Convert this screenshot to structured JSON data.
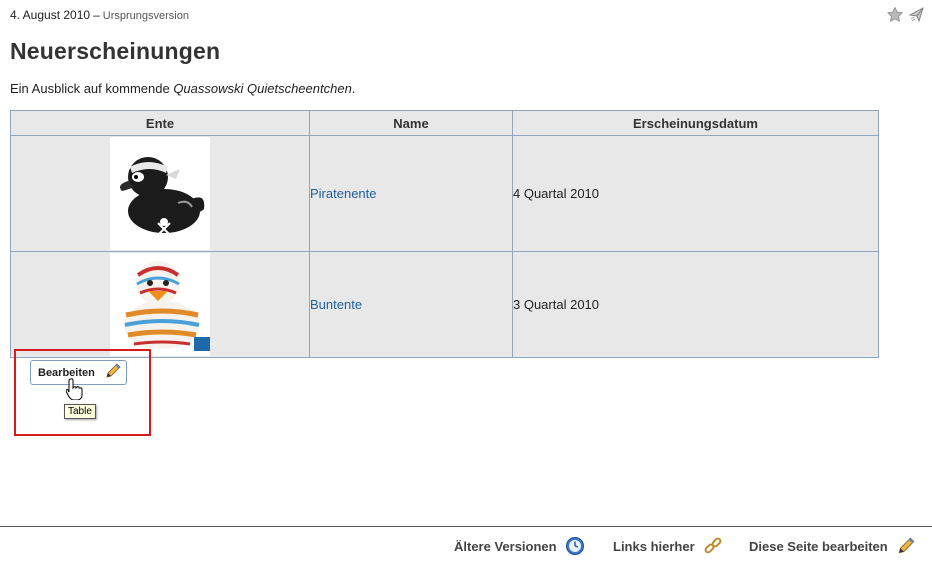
{
  "header": {
    "date": "4. August 2010",
    "separator": "–",
    "version": "Ursprungsversion",
    "icons": [
      "star-icon",
      "feed-icon"
    ]
  },
  "page": {
    "title": "Neuerscheinungen",
    "intro_text": "Ein Ausblick auf kommende ",
    "intro_emphasis": "Quassowski Quietscheentchen",
    "intro_end": "."
  },
  "table": {
    "columns": [
      "Ente",
      "Name",
      "Erscheinungsdatum"
    ],
    "rows": [
      {
        "image": "pirate-duck-image",
        "name": "Piratenente",
        "date": "4 Quartal 2010"
      },
      {
        "image": "striped-duck-image",
        "name": "Buntente",
        "date": "3 Quartal 2010"
      }
    ]
  },
  "edit_button": {
    "label": "Bearbeiten",
    "icon": "pencil-icon"
  },
  "tooltip": {
    "text": "Table"
  },
  "footer": {
    "older_versions": "Ältere Versionen",
    "links_here": "Links hierher",
    "edit_page": "Diese Seite bearbeiten"
  },
  "colors": {
    "link": "#1f5f9c",
    "highlight": "#d41c1c",
    "table_border": "#8fa6bf",
    "table_bg": "#e8e8e8"
  }
}
